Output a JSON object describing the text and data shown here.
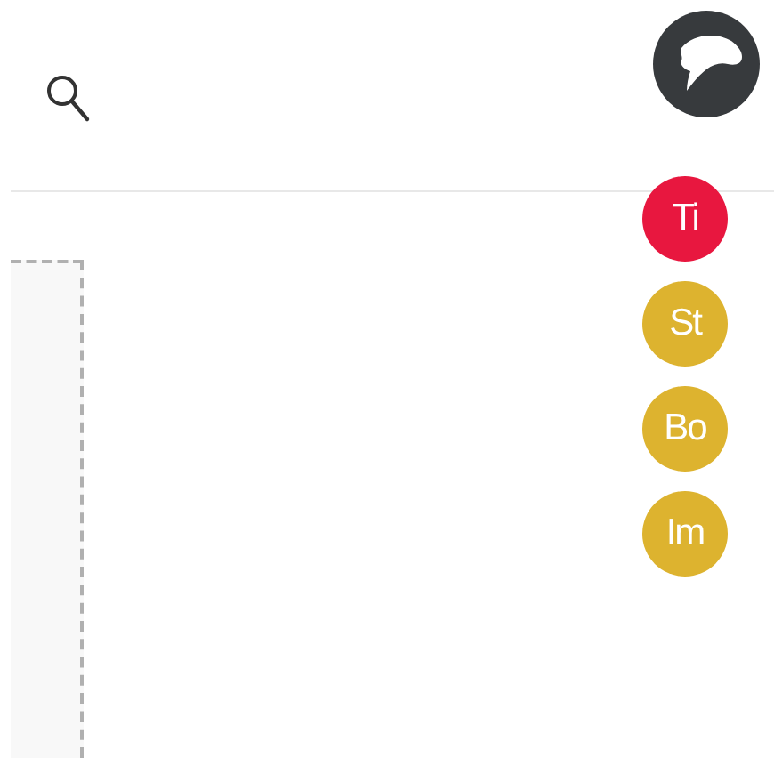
{
  "avatars": [
    {
      "initials": "Ti",
      "color": "#e8173f"
    },
    {
      "initials": "St",
      "color": "#ddb32f"
    },
    {
      "initials": "Bo",
      "color": "#ddb32f"
    },
    {
      "initials": "Im",
      "color": "#ddb32f"
    }
  ]
}
